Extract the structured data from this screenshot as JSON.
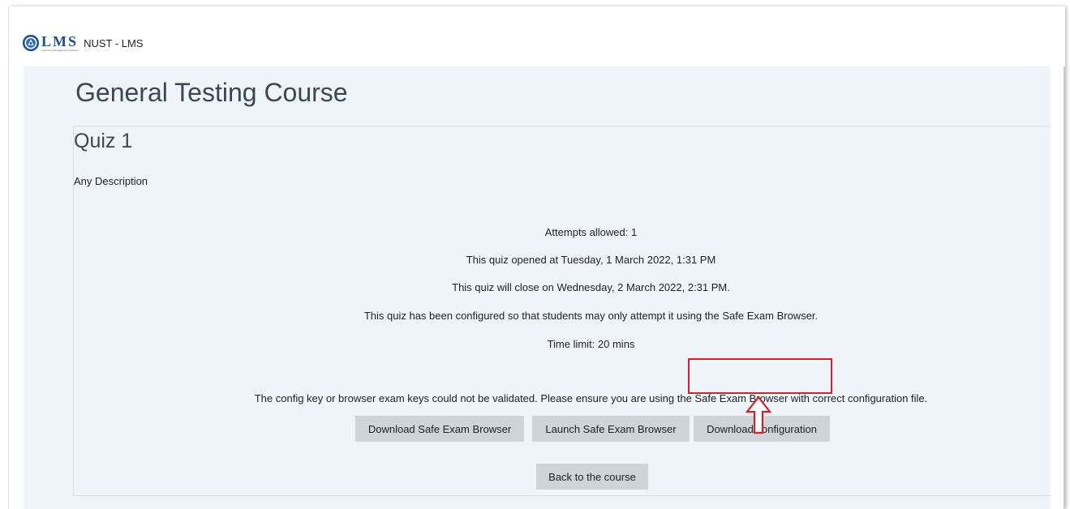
{
  "header": {
    "logo_text": "LMS",
    "logo_subtext": "Learning Management System",
    "site_name": "NUST - LMS"
  },
  "course": {
    "title": "General Testing Course"
  },
  "quiz": {
    "title": "Quiz 1",
    "description": "Any Description",
    "info": [
      "Attempts allowed: 1",
      "This quiz opened at Tuesday, 1 March 2022, 1:31 PM",
      "This quiz will close on Wednesday, 2 March 2022, 2:31 PM.",
      "This quiz has been configured so that students may only attempt it using the Safe Exam Browser.",
      "Time limit: 20 mins"
    ],
    "warning": "The config key or browser exam keys could not be validated. Please ensure you are using the Safe Exam Browser with correct configuration file."
  },
  "buttons": {
    "download_seb": "Download Safe Exam Browser",
    "launch_seb": "Launch Safe Exam Browser",
    "download_config": "Download configuration",
    "back_to_course": "Back to the course"
  },
  "colors": {
    "page_background": "#eef4f7",
    "button_background": "#ced4da",
    "brand_blue": "#1f4f87",
    "highlight_red": "#d4202a"
  },
  "icons": {
    "logo": "university-seal-icon",
    "annotation": "up-arrow-icon"
  }
}
